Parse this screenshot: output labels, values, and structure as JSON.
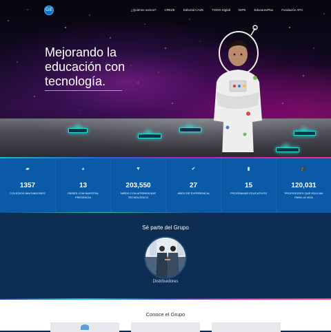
{
  "header": {
    "logo_text": "GE",
    "nav": [
      "¿Quiénes somos?",
      "CREZE",
      "Editorial CAZE",
      "TODO Digital",
      "DIPE",
      "EducaresPlus",
      "Fundación AFC"
    ]
  },
  "hero": {
    "headline": "Mejorando la educación con tecnología."
  },
  "stats": [
    {
      "icon": "book-icon",
      "glyph": "▰",
      "number": "1357",
      "label": "Colegios innovadores"
    },
    {
      "icon": "globe-icon",
      "glyph": "◕",
      "number": "13",
      "label": "Países con nuestra presencia"
    },
    {
      "icon": "shirt-icon",
      "glyph": "▼",
      "number": "203,550",
      "label": "Niños con aprendizaje tecnológico"
    },
    {
      "icon": "check-icon",
      "glyph": "✔",
      "number": "27",
      "label": "Años de experiencia"
    },
    {
      "icon": "bookmark-icon",
      "glyph": "▮",
      "number": "15",
      "label": "Programas educativos"
    },
    {
      "icon": "graduation-cap-icon",
      "glyph": "🎓",
      "number": "120,031",
      "label": "Profesores que educan para la vida"
    }
  ],
  "grupo": {
    "title": "Sé parte del Grupo",
    "distribuidores_label": "Distribuidores"
  },
  "conoce": {
    "title": "Conoce el Grupo"
  },
  "colors": {
    "stats_bg": "#0a5aa8",
    "grupo_bg": "#0d2d52",
    "accent_teal": "#26e0d6"
  }
}
